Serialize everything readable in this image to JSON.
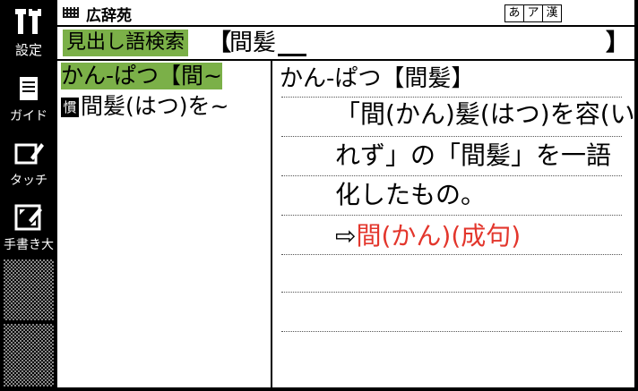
{
  "sidebar": {
    "items": [
      {
        "label": "設定",
        "icon": "tools-icon"
      },
      {
        "label": "ガイド",
        "icon": "document-icon"
      },
      {
        "label": "タッチ",
        "icon": "touch-pen-icon"
      },
      {
        "label": "手書き大",
        "icon": "expand-handwriting-icon"
      }
    ]
  },
  "titlebar": {
    "title": "広辞苑",
    "modes": [
      "あ",
      "ア",
      "漢"
    ]
  },
  "search": {
    "label": "見出し語検索",
    "bracket_open": "【",
    "query": "間髪",
    "bracket_close": "】"
  },
  "results": [
    {
      "text": "かん‐ぱつ【間~",
      "badge": "",
      "selected": true
    },
    {
      "text": "間髪(はつ)を~",
      "badge": "慣",
      "selected": false
    }
  ],
  "detail": {
    "headword": "かん‐ぱつ【間髪】",
    "lines": [
      "「間(かん)髪(はつ)を容(い)",
      "れず」の「間髪」を一語",
      "化したもの。"
    ],
    "reference_arrow": "⇨",
    "reference": "間(かん)(成句)"
  },
  "colors": {
    "accent": "#7bb048",
    "link": "#e3362c"
  }
}
